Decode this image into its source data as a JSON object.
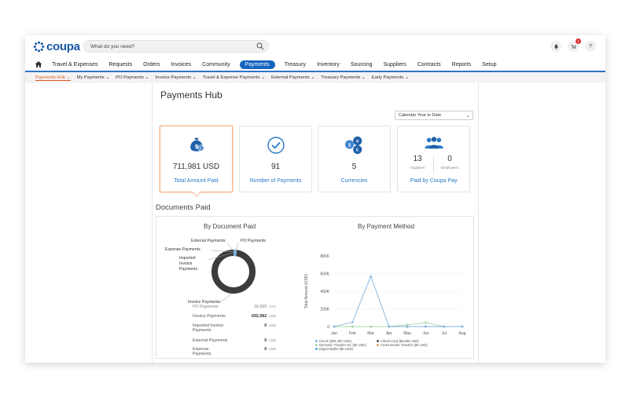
{
  "app": {
    "name": "coupa"
  },
  "search": {
    "placeholder": "What do you need?"
  },
  "top_icons": {
    "notification_badge": "1"
  },
  "main_nav": [
    {
      "label": "Travel & Expenses"
    },
    {
      "label": "Requests"
    },
    {
      "label": "Orders"
    },
    {
      "label": "Invoices"
    },
    {
      "label": "Community"
    },
    {
      "label": "Payments",
      "active": true
    },
    {
      "label": "Treasury"
    },
    {
      "label": "Inventory"
    },
    {
      "label": "Sourcing"
    },
    {
      "label": "Suppliers"
    },
    {
      "label": "Contracts"
    },
    {
      "label": "Reports"
    },
    {
      "label": "Setup"
    }
  ],
  "sub_nav": [
    {
      "label": "Payments Hub"
    },
    {
      "label": "My Payments"
    },
    {
      "label": "PO Payments"
    },
    {
      "label": "Invoice Payments"
    },
    {
      "label": "Travel & Expense Payments"
    },
    {
      "label": "External Payments"
    },
    {
      "label": "Treasury Payments"
    },
    {
      "label": "Early Payments"
    }
  ],
  "page": {
    "title": "Payments Hub",
    "period": "Calendar Year to Date"
  },
  "cards": [
    {
      "value": "711,981 USD",
      "label": "Total Amount Paid"
    },
    {
      "value": "91",
      "label": "Number of Payments"
    },
    {
      "value": "5",
      "label": "Currencies"
    },
    {
      "label": "Paid by Coupa Pay",
      "suppliers": "13",
      "suppliers_label": "Suppliers",
      "employees": "0",
      "employees_label": "Employees"
    }
  ],
  "documents": {
    "section_title": "Documents Paid",
    "by_document_title": "By Document Paid",
    "by_method_title": "By Payment Method",
    "donut_labels": {
      "external": "External Payments",
      "po": "PO Payments",
      "expense": "Expense Payments",
      "imported_l1": "Imported",
      "imported_l2": "Invoice",
      "imported_l3": "Payments",
      "invoice": "Invoice Payments"
    },
    "table": [
      {
        "label": "PO Payments",
        "value": "18,999",
        "unit": "USD"
      },
      {
        "label": "Invoice Payments",
        "value": "692,982",
        "unit": "USD"
      },
      {
        "label_l1": "Imported Invoice",
        "label_l2": "Payments",
        "value": "0",
        "unit": "USD"
      },
      {
        "label": "External Payments",
        "value": "0",
        "unit": "USD"
      },
      {
        "label_l1": "Expense",
        "label_l2": "Payments",
        "value": "0",
        "unit": "USD"
      }
    ]
  },
  "chart_data": {
    "type": "line",
    "title": "By Payment Method",
    "ylabel": "Total Amount (USD)",
    "xlabel": "",
    "categories": [
      "Jan",
      "Feb",
      "Mar",
      "Apr",
      "May",
      "Jun",
      "Jul",
      "Aug"
    ],
    "yticks": [
      "0",
      "200K",
      "400K",
      "600K",
      "800K"
    ],
    "ylim": [
      0,
      800000
    ],
    "series": [
      {
        "name": "Check ($94,390 USD)",
        "color": "#7fb3e0",
        "values": [
          0,
          50000,
          570000,
          0,
          0,
          0,
          0,
          0
        ]
      },
      {
        "name": "Virtual Card ($6,988 USD)",
        "color": "#555555",
        "values": [
          0,
          0,
          0,
          0,
          0,
          0,
          0,
          0
        ]
      },
      {
        "name": "Domestic Transfer HC ($0 USD)",
        "color": "#a8d8a0",
        "values": [
          0,
          0,
          0,
          0,
          20000,
          45000,
          0,
          0
        ]
      },
      {
        "name": "Cross Border Transfer ($0 USD)",
        "color": "#e0a060",
        "values": [
          0,
          0,
          0,
          0,
          0,
          0,
          0,
          0
        ]
      },
      {
        "name": "Digital Wallet ($0 USD)",
        "color": "#4aa3d9",
        "values": [
          0,
          0,
          0,
          0,
          0,
          0,
          0,
          0
        ]
      }
    ]
  },
  "colors": {
    "brand": "#1a56a6",
    "accent_active_nav": "#1565c0",
    "link": "#2a7ac7",
    "sub_active": "#e05a1e"
  }
}
